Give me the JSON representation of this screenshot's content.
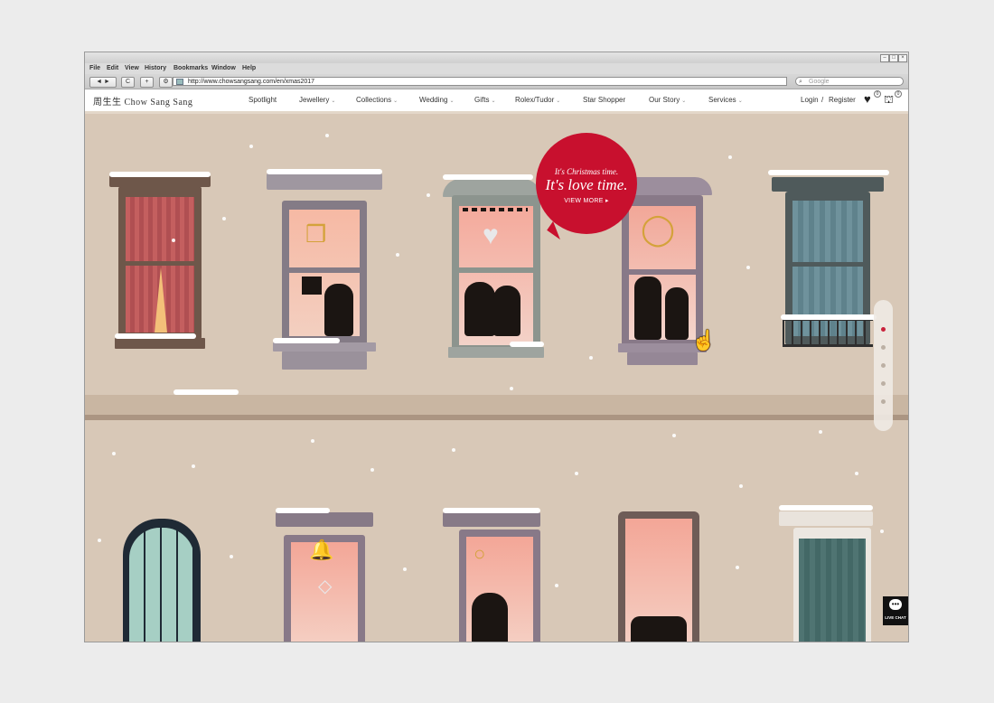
{
  "browser": {
    "menu": [
      "File",
      "Edit",
      "View",
      "History",
      "Bookmarks",
      "Window",
      "Help"
    ],
    "url": "http://www.chowsangsang.com/en/xmas2017",
    "search_placeholder": "Google",
    "back_icon": "◄ ►",
    "reload_icon": "C",
    "add_icon": "+",
    "action_icon": "⚙"
  },
  "site": {
    "logo": "周生生 Chow Sang Sang",
    "nav": [
      {
        "label": "Spotlight",
        "caret": ""
      },
      {
        "label": "Jewellery",
        "caret": "⌄"
      },
      {
        "label": "Collections",
        "caret": "⌄"
      },
      {
        "label": "Wedding",
        "caret": "⌄"
      },
      {
        "label": "Gifts",
        "caret": "⌄"
      },
      {
        "label": "Rolex/Tudor",
        "caret": "⌄"
      },
      {
        "label": "Star Shopper",
        "caret": ""
      },
      {
        "label": "Our Story",
        "caret": "⌄"
      },
      {
        "label": "Services",
        "caret": "⌄"
      }
    ],
    "login": "Login",
    "slash": "/",
    "register": "Register",
    "wishlist_count": "0",
    "cart_count": "0"
  },
  "promo": {
    "line1": "It's Christmas time.",
    "line2": "It's love time.",
    "cta": "VIEW MORE ▸"
  },
  "pager": {
    "active_index": 0,
    "count": 5
  },
  "livechat": {
    "label": "LIVE CHAT"
  },
  "colors": {
    "accent_red": "#c8102e",
    "wall": "#d8c8b7"
  }
}
